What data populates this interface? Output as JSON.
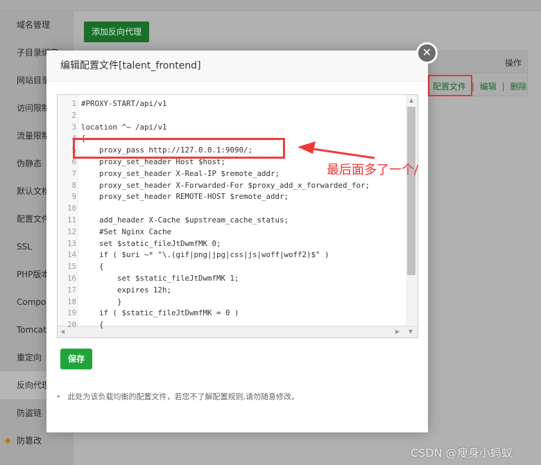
{
  "sidebar": {
    "items": [
      "域名管理",
      "子目录绑定",
      "网站目录",
      "访问限制",
      "流量限制",
      "伪静态",
      "默认文档",
      "配置文件",
      "SSL",
      "PHP版本",
      "Composer",
      "Tomcat",
      "重定向",
      "反向代理",
      "防盗链",
      "防篡改"
    ],
    "active": "反向代理"
  },
  "main": {
    "add_button": "添加反向代理",
    "table_header_ops": "操作",
    "row_actions": {
      "config": "配置文件",
      "edit": "编辑",
      "delete": "删除",
      "sep": "|"
    }
  },
  "modal": {
    "title": "编辑配置文件[talent_frontend]",
    "save": "保存",
    "note": "此处为该负载均衡的配置文件，若您不了解配置规则,请勿随意修改。",
    "code_lines": [
      "#PROXY-START/api/v1",
      "",
      "location ^~ /api/v1",
      "{",
      "    proxy_pass http://127.0.0.1:9090/;",
      "    proxy_set_header Host $host;",
      "    proxy_set_header X-Real-IP $remote_addr;",
      "    proxy_set_header X-Forwarded-For $proxy_add_x_forwarded_for;",
      "    proxy_set_header REMOTE-HOST $remote_addr;",
      "",
      "    add_header X-Cache $upstream_cache_status;",
      "    #Set Nginx Cache",
      "    set $static_fileJtDwmfMK 0;",
      "    if ( $uri ~* \"\\.(gif|png|jpg|css|js|woff|woff2)$\" )",
      "    {",
      "        set $static_fileJtDwmfMK 1;",
      "        expires 12h;",
      "        }",
      "    if ( $static_fileJtDwmfMK = 0 )",
      "    {"
    ]
  },
  "annotation": {
    "text": "最后面多了一个/",
    "color": "#f03232"
  },
  "watermark": "CSDN @瘦身小蚂蚁"
}
